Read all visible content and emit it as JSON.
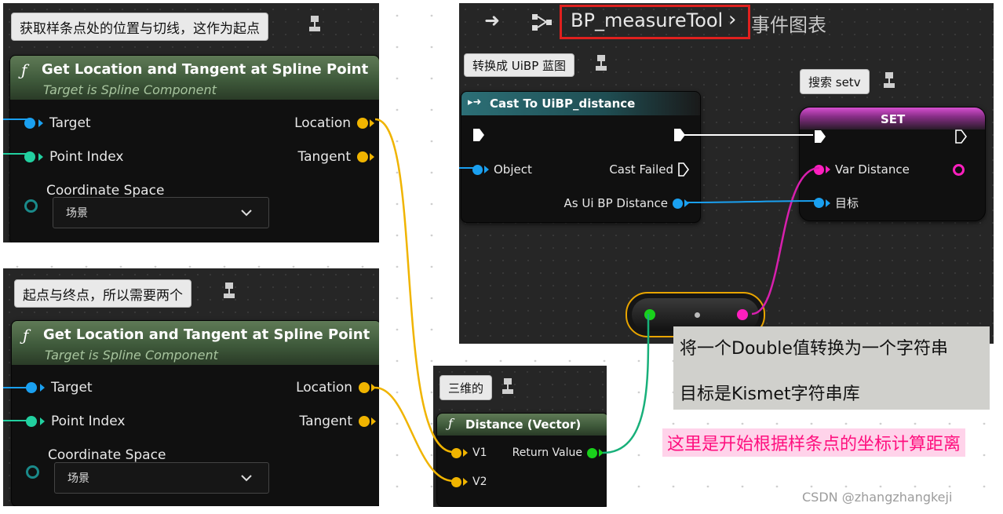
{
  "panels": {
    "left_top": {
      "comment": "获取样条点处的位置与切线，这作为起点",
      "node_title": "Get Location and Tangent at Spline Point",
      "node_subtitle": "Target is Spline Component",
      "pins": {
        "target": "Target",
        "point_index": "Point Index",
        "coordinate_space": "Coordinate Space",
        "location": "Location",
        "tangent": "Tangent"
      },
      "dropdown_value": "场景"
    },
    "left_bottom": {
      "comment": "起点与终点，所以需要两个",
      "node_title": "Get Location and Tangent at Spline Point",
      "node_subtitle": "Target is Spline Component",
      "pins": {
        "target": "Target",
        "point_index": "Point Index",
        "coordinate_space": "Coordinate Space",
        "location": "Location",
        "tangent": "Tangent"
      },
      "dropdown_value": "场景"
    },
    "distance": {
      "comment": "三维的",
      "node_title": "Distance (Vector)",
      "pins": {
        "v1": "V1",
        "v2": "V2",
        "return_value": "Return Value"
      }
    },
    "blueprint": {
      "breadcrumb_title": "BP_measureTool",
      "breadcrumb_sep": "›",
      "breadcrumb_graph": "事件图表",
      "cast_comment": "转换成 UiBP 蓝图",
      "cast_title": "Cast To UiBP_distance",
      "cast_pins": {
        "object": "Object",
        "cast_failed": "Cast Failed",
        "as_ui": "As Ui BP Distance"
      },
      "set_comment": "搜索 setv",
      "set_title": "SET",
      "set_pins": {
        "var_distance": "Var Distance",
        "target": "目标"
      }
    }
  },
  "tooltip": {
    "line1": "将一个Double值转换为一个字符串",
    "line2": "目标是Kismet字符串库"
  },
  "annotation": "这里是开始根据样条点的坐标计算距离",
  "watermark": "CSDN @zhangzhangkeji",
  "colors": {
    "pin_object": "#1aa0f0",
    "pin_int": "#22d0a0",
    "pin_vector": "#f0b400",
    "pin_float": "#19d11b",
    "pin_string": "#ff1fbf",
    "highlight": "#e0201e",
    "annotation_bg": "#ffd3ea",
    "annotation_text": "#ff0f7e"
  }
}
